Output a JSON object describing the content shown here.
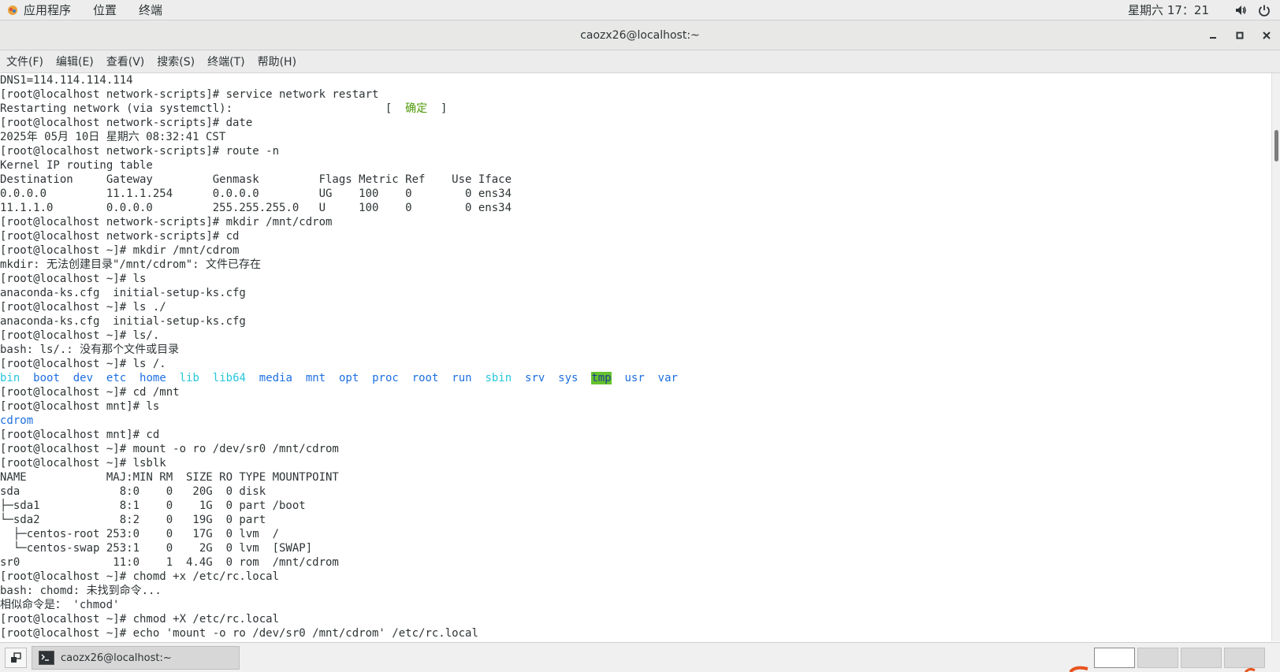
{
  "top_panel": {
    "apps": "应用程序",
    "places": "位置",
    "terminal": "终端",
    "clock": "星期六 17：21"
  },
  "window": {
    "title": "caozx26@localhost:~"
  },
  "menubar": {
    "items": [
      "文件(F)",
      "编辑(E)",
      "查看(V)",
      "搜索(S)",
      "终端(T)",
      "帮助(H)"
    ]
  },
  "terminal": {
    "lines": [
      "DNS1=114.114.114.114",
      "[root@localhost network-scripts]# service network restart",
      "Restarting network (via systemctl):                       [",
      "[root@localhost network-scripts]# date",
      "2025年 05月 10日 星期六 08:32:41 CST",
      "[root@localhost network-scripts]# route -n",
      "Kernel IP routing table",
      "Destination     Gateway         Genmask         Flags Metric Ref    Use Iface",
      "0.0.0.0         11.1.1.254      0.0.0.0         UG    100    0        0 ens34",
      "11.1.1.0        0.0.0.0         255.255.255.0   U     100    0        0 ens34",
      "[root@localhost network-scripts]# mkdir /mnt/cdrom",
      "[root@localhost network-scripts]# cd",
      "[root@localhost ~]# mkdir /mnt/cdrom",
      "mkdir: 无法创建目录\"/mnt/cdrom\": 文件已存在",
      "[root@localhost ~]# ls",
      "anaconda-ks.cfg  initial-setup-ks.cfg",
      "[root@localhost ~]# ls ./",
      "anaconda-ks.cfg  initial-setup-ks.cfg",
      "[root@localhost ~]# ls/.",
      "bash: ls/.: 没有那个文件或目录",
      "[root@localhost ~]# ls /."
    ],
    "restart_ok": "确定",
    "restart_close": "]",
    "ls_root": [
      {
        "name": "bin",
        "style": "cyan"
      },
      {
        "name": "boot",
        "style": "blue"
      },
      {
        "name": "dev",
        "style": "blue"
      },
      {
        "name": "etc",
        "style": "blue"
      },
      {
        "name": "home",
        "style": "blue"
      },
      {
        "name": "lib",
        "style": "cyan"
      },
      {
        "name": "lib64",
        "style": "cyan"
      },
      {
        "name": "media",
        "style": "blue"
      },
      {
        "name": "mnt",
        "style": "blue"
      },
      {
        "name": "opt",
        "style": "blue"
      },
      {
        "name": "proc",
        "style": "blue"
      },
      {
        "name": "root",
        "style": "blue"
      },
      {
        "name": "run",
        "style": "blue"
      },
      {
        "name": "sbin",
        "style": "cyan"
      },
      {
        "name": "srv",
        "style": "blue"
      },
      {
        "name": "sys",
        "style": "blue"
      },
      {
        "name": "tmp",
        "style": "tmp"
      },
      {
        "name": "usr",
        "style": "blue"
      },
      {
        "name": "var",
        "style": "blue"
      }
    ],
    "lines2": [
      "[root@localhost ~]# cd /mnt",
      "[root@localhost mnt]# ls"
    ],
    "cdrom": "cdrom",
    "lines3": [
      "[root@localhost mnt]# cd",
      "[root@localhost ~]# mount -o ro /dev/sr0 /mnt/cdrom",
      "[root@localhost ~]# lsblk",
      "NAME            MAJ:MIN RM  SIZE RO TYPE MOUNTPOINT",
      "sda               8:0    0   20G  0 disk",
      "├─sda1            8:1    0    1G  0 part /boot",
      "└─sda2            8:2    0   19G  0 part",
      "  ├─centos-root 253:0    0   17G  0 lvm  /",
      "  └─centos-swap 253:1    0    2G  0 lvm  [SWAP]",
      "sr0              11:0    1  4.4G  0 rom  /mnt/cdrom",
      "[root@localhost ~]# chomd +x /etc/rc.local",
      "bash: chomd: 未找到命令...",
      "相似命令是： 'chmod'",
      "[root@localhost ~]# chmod +X /etc/rc.local",
      "[root@localhost ~]# echo 'mount -o ro /dev/sr0 /mnt/cdrom' /etc/rc.local"
    ]
  },
  "taskbar": {
    "window_label": "caozx26@localhost:~"
  },
  "icons": {
    "apps": "apps-icon",
    "volume": "volume-icon",
    "power": "power-icon",
    "minimize": "minimize-icon",
    "maximize": "maximize-icon",
    "close": "close-icon",
    "show_desktop": "show-desktop-icon",
    "terminal": "terminal-icon"
  },
  "colors": {
    "ok_green": "#4e9a06",
    "dir_blue": "#1d6fe0",
    "link_cyan": "#26c6da",
    "tmp_bg": "#66c22e"
  }
}
